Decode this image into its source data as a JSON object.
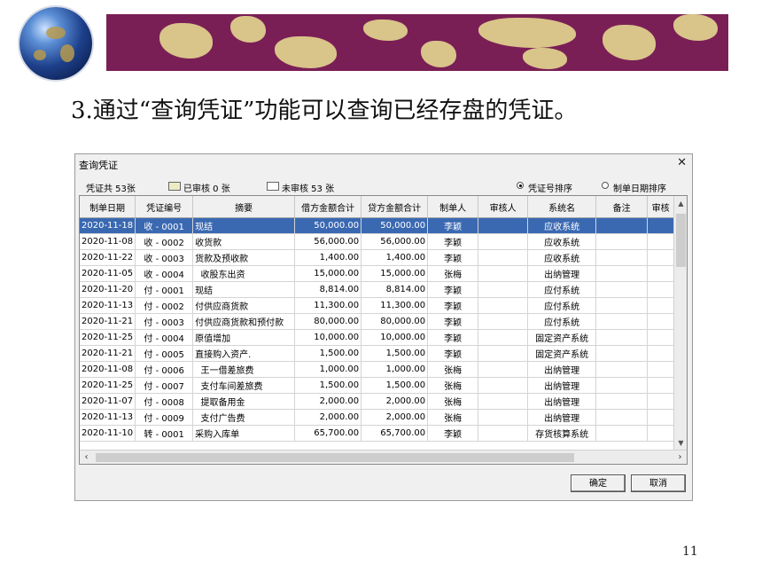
{
  "slide": {
    "title": "3.通过“查询凭证”功能可以查询已经存盘的凭证。",
    "page_number": "11"
  },
  "dialog": {
    "title": "查询凭证",
    "close_glyph": "✕",
    "summary": {
      "total": "凭证共 53张",
      "audited": "已审核 0 张",
      "unaudited": "未审核 53 张"
    },
    "sort_options": {
      "by_voucher": "凭证号排序",
      "by_date": "制单日期排序",
      "selected": "by_voucher"
    },
    "columns": [
      "制单日期",
      "凭证编号",
      "摘要",
      "借方金额合计",
      "贷方金额合计",
      "制单人",
      "审核人",
      "系统名",
      "备注",
      "审核"
    ],
    "rows": [
      [
        "2020-11-18",
        "收 - 0001",
        "现结",
        "50,000.00",
        "50,000.00",
        "李颖",
        "",
        "应收系统",
        "",
        ""
      ],
      [
        "2020-11-08",
        "收 - 0002",
        "收货款",
        "56,000.00",
        "56,000.00",
        "李颖",
        "",
        "应收系统",
        "",
        ""
      ],
      [
        "2020-11-22",
        "收 - 0003",
        "货款及预收款",
        "1,400.00",
        "1,400.00",
        "李颖",
        "",
        "应收系统",
        "",
        ""
      ],
      [
        "2020-11-05",
        "收 - 0004",
        "  收股东出资",
        "15,000.00",
        "15,000.00",
        "张梅",
        "",
        "出纳管理",
        "",
        ""
      ],
      [
        "2020-11-20",
        "付 - 0001",
        "现结",
        "8,814.00",
        "8,814.00",
        "李颖",
        "",
        "应付系统",
        "",
        ""
      ],
      [
        "2020-11-13",
        "付 - 0002",
        "付供应商货款",
        "11,300.00",
        "11,300.00",
        "李颖",
        "",
        "应付系统",
        "",
        ""
      ],
      [
        "2020-11-21",
        "付 - 0003",
        "付供应商货款和预付款",
        "80,000.00",
        "80,000.00",
        "李颖",
        "",
        "应付系统",
        "",
        ""
      ],
      [
        "2020-11-25",
        "付 - 0004",
        "原值增加",
        "10,000.00",
        "10,000.00",
        "李颖",
        "",
        "固定资产系统",
        "",
        ""
      ],
      [
        "2020-11-21",
        "付 - 0005",
        "直接购入资产.",
        "1,500.00",
        "1,500.00",
        "李颖",
        "",
        "固定资产系统",
        "",
        ""
      ],
      [
        "2020-11-08",
        "付 - 0006",
        "  王一借差旅费",
        "1,000.00",
        "1,000.00",
        "张梅",
        "",
        "出纳管理",
        "",
        ""
      ],
      [
        "2020-11-25",
        "付 - 0007",
        "  支付车间差旅费",
        "1,500.00",
        "1,500.00",
        "张梅",
        "",
        "出纳管理",
        "",
        ""
      ],
      [
        "2020-11-07",
        "付 - 0008",
        "  提取备用金",
        "2,000.00",
        "2,000.00",
        "张梅",
        "",
        "出纳管理",
        "",
        ""
      ],
      [
        "2020-11-13",
        "付 - 0009",
        "  支付广告费",
        "2,000.00",
        "2,000.00",
        "张梅",
        "",
        "出纳管理",
        "",
        ""
      ],
      [
        "2020-11-10",
        "转 - 0001",
        "采购入库单",
        "65,700.00",
        "65,700.00",
        "李颖",
        "",
        "存货核算系统",
        "",
        ""
      ]
    ],
    "selected_row": 0,
    "buttons": {
      "ok": "确定",
      "cancel": "取消"
    }
  },
  "colors": {
    "banner": "#7a1f56",
    "banner_land": "#d9c48a",
    "selection": "#3a69b2",
    "audited_swatch": "#ecebc6",
    "unaudited_swatch": "#ffffff"
  },
  "icons": {
    "globe": "globe-icon",
    "close": "close-icon",
    "scroll_up": "chevron-up-icon",
    "scroll_down": "chevron-down-icon",
    "scroll_left": "chevron-left-icon",
    "scroll_right": "chevron-right-icon"
  }
}
